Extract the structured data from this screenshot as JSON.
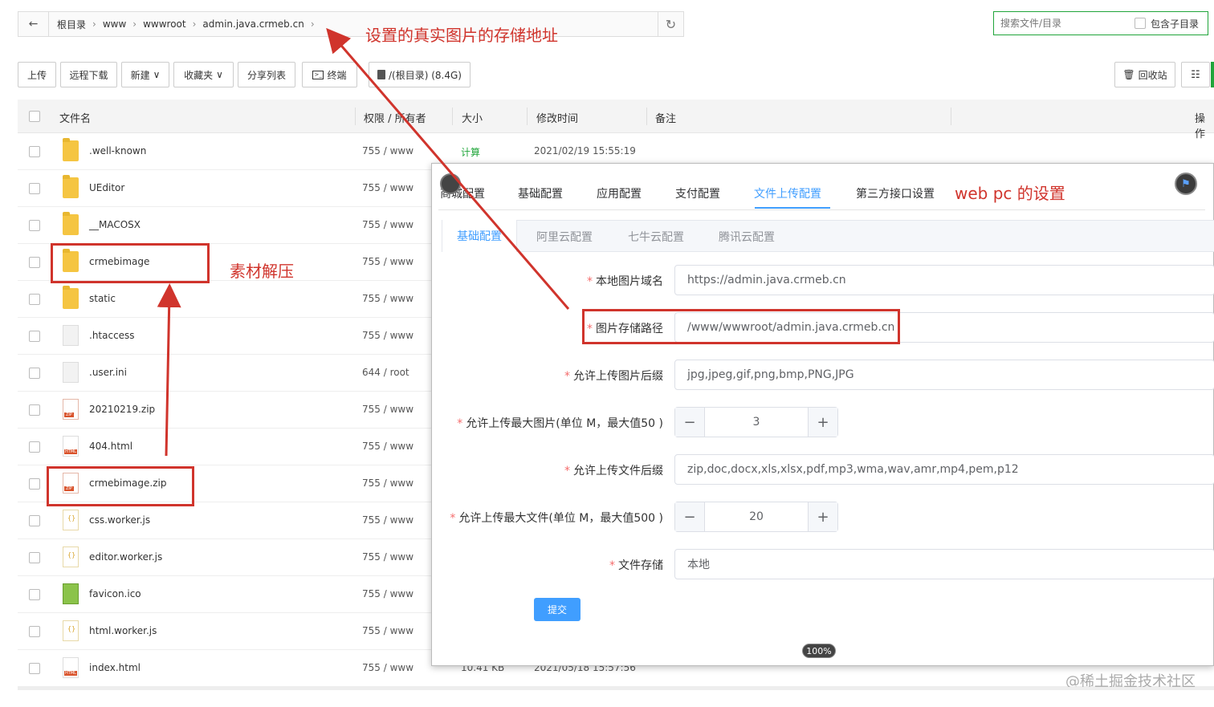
{
  "pathbar": {
    "back_icon": "arrow-left-icon",
    "crumbs": [
      "根目录",
      "www",
      "wwwroot",
      "admin.java.crmeb.cn"
    ],
    "refresh_icon": "refresh-icon"
  },
  "search": {
    "placeholder": "搜索文件/目录",
    "include_sub_label": "包含子目录"
  },
  "toolbar": {
    "upload": "上传",
    "remote_download": "远程下载",
    "new": "新建",
    "favorites": "收藏夹",
    "share_list": "分享列表",
    "terminal": "终端",
    "disk": "/(根目录) (8.4G)",
    "recycle": "回收站"
  },
  "table": {
    "headers": {
      "name": "文件名",
      "perm": "权限 / 所有者",
      "size": "大小",
      "mtime": "修改时间",
      "remark": "备注",
      "ops": "操作"
    },
    "rows": [
      {
        "name": ".well-known",
        "type": "folder",
        "perm": "755 / www",
        "size": "计算",
        "mtime": "2021/02/19 15:55:19"
      },
      {
        "name": "UEditor",
        "type": "folder",
        "perm": "755 / www"
      },
      {
        "name": "__MACOSX",
        "type": "folder",
        "perm": "755 / www"
      },
      {
        "name": "crmebimage",
        "type": "folder",
        "perm": "755 / www"
      },
      {
        "name": "static",
        "type": "folder",
        "perm": "755 / www"
      },
      {
        "name": ".htaccess",
        "type": "doc",
        "perm": "755 / www"
      },
      {
        "name": ".user.ini",
        "type": "doc",
        "perm": "644 / root"
      },
      {
        "name": "20210219.zip",
        "type": "zip",
        "perm": "755 / www"
      },
      {
        "name": "404.html",
        "type": "html",
        "perm": "755 / www"
      },
      {
        "name": "crmebimage.zip",
        "type": "zip",
        "perm": "755 / www"
      },
      {
        "name": "css.worker.js",
        "type": "js",
        "perm": "755 / www"
      },
      {
        "name": "editor.worker.js",
        "type": "js",
        "perm": "755 / www"
      },
      {
        "name": "favicon.ico",
        "type": "ico",
        "perm": "755 / www"
      },
      {
        "name": "html.worker.js",
        "type": "js",
        "perm": "755 / www"
      },
      {
        "name": "index.html",
        "type": "html",
        "perm": "755 / www",
        "size": "10.41 KB",
        "mtime": "2021/05/18 15:57:56"
      }
    ]
  },
  "annotations": {
    "storage_addr": "设置的真实图片的存储地址",
    "unzip": "素材解压",
    "webpc": "web pc 的设置"
  },
  "modal": {
    "tabs": [
      "商城配置",
      "基础配置",
      "应用配置",
      "支付配置",
      "文件上传配置",
      "第三方接口设置"
    ],
    "active_tab": "文件上传配置",
    "subtabs": [
      "基础配置",
      "阿里云配置",
      "七牛云配置",
      "腾讯云配置"
    ],
    "fields": {
      "domain_label": "本地图片域名",
      "domain_value": "https://admin.java.crmeb.cn",
      "path_label": "图片存储路径",
      "path_value": "/www/wwwroot/admin.java.crmeb.cn",
      "img_ext_label": "允许上传图片后缀",
      "img_ext_value": "jpg,jpeg,gif,png,bmp,PNG,JPG",
      "img_max_label": "允许上传最大图片(单位 M，最大值50 )",
      "img_max_value": "3",
      "file_ext_label": "允许上传文件后缀",
      "file_ext_value": "zip,doc,docx,xls,xlsx,pdf,mp3,wma,wav,amr,mp4,pem,p12",
      "file_max_label": "允许上传最大文件(单位 M，最大值500 )",
      "file_max_value": "20",
      "storage_label": "文件存储",
      "storage_value": "本地"
    },
    "submit": "提交",
    "zoom": "100%"
  },
  "watermark": "@稀土掘金技术社区",
  "colors": {
    "accent": "#409eff",
    "annotation": "#d0342c",
    "bt_green": "#20a53a"
  }
}
